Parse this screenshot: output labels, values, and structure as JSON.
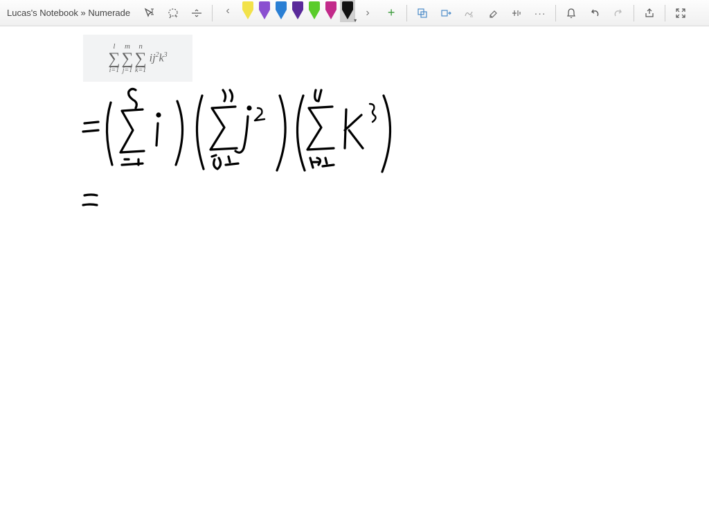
{
  "breadcrumb": "Lucas's Notebook » Numerade",
  "math": {
    "s1_upper": "l",
    "s1_lower": "i=1",
    "s2_upper": "m",
    "s2_lower": "j=1",
    "s3_upper": "n",
    "s3_lower": "k=1",
    "term": "ij²k³"
  },
  "pens": [
    {
      "name": "yellow",
      "tip": "#f2e24a",
      "body": "#f2e24a"
    },
    {
      "name": "purple",
      "tip": "#8a4fd0",
      "body": "#8a4fd0"
    },
    {
      "name": "blue",
      "tip": "#2a7fd4",
      "body": "#2a7fd4"
    },
    {
      "name": "darkpurple",
      "tip": "#5a2a9a",
      "body": "#5a2a9a"
    },
    {
      "name": "green",
      "tip": "#5acc2a",
      "body": "#5acc2a"
    },
    {
      "name": "magenta",
      "tip": "#c22a8a",
      "body": "#c22a8a"
    },
    {
      "name": "black",
      "tip": "#111",
      "body": "#111",
      "selected": true
    }
  ],
  "icons": {
    "text_cursor": "cursor-text",
    "lasso": "lasso",
    "hsplit": "split",
    "prev": "‹",
    "next": "›",
    "add": "+",
    "shape1": "rect-overlap",
    "shape2": "rect-arrow",
    "ink_text": "ink-to-text",
    "eraser": "eraser",
    "math_tool": "math",
    "more": "···",
    "bell": "bell",
    "undo": "undo",
    "redo": "redo",
    "share": "share",
    "collapse": "collapse"
  }
}
